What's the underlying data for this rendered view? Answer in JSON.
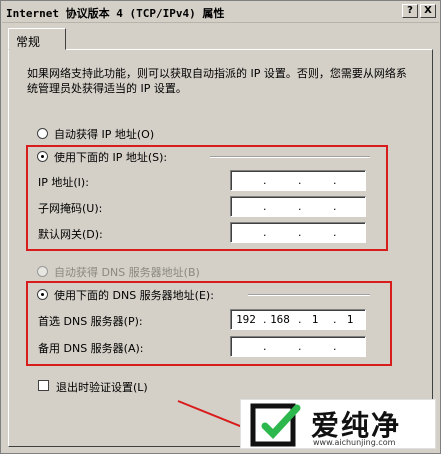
{
  "window": {
    "title": "Internet 协议版本 4 (TCP/IPv4) 属性",
    "help_btn": "?",
    "close_btn": "X"
  },
  "tabs": [
    {
      "label": "常规"
    }
  ],
  "description": "如果网络支持此功能，则可以获取自动指派的 IP 设置。否则，您需要从网络系统管理员处获得适当的 IP 设置。",
  "ip_section": {
    "auto_label": "自动获得 IP 地址(O)",
    "manual_label": "使用下面的 IP 地址(S):",
    "selected": "manual",
    "fields": [
      {
        "label": "IP 地址(I):",
        "octets": [
          "",
          "",
          "",
          ""
        ]
      },
      {
        "label": "子网掩码(U):",
        "octets": [
          "",
          "",
          "",
          ""
        ]
      },
      {
        "label": "默认网关(D):",
        "octets": [
          "",
          "",
          "",
          ""
        ]
      }
    ]
  },
  "dns_section": {
    "auto_label": "自动获得 DNS 服务器地址(B)",
    "manual_label": "使用下面的 DNS 服务器地址(E):",
    "selected": "manual",
    "fields": [
      {
        "label": "首选 DNS 服务器(P):",
        "octets": [
          "192",
          "168",
          "1",
          "1"
        ]
      },
      {
        "label": "备用 DNS 服务器(A):",
        "octets": [
          "",
          "",
          "",
          ""
        ]
      }
    ]
  },
  "validate_checkbox": {
    "label": "退出时验证设置(L)",
    "checked": false
  },
  "watermark": {
    "brand": "爱纯净",
    "url": "www.aichunjing.com"
  },
  "colors": {
    "highlight": "#d81b1b",
    "dialog": "#d4d0c8"
  }
}
